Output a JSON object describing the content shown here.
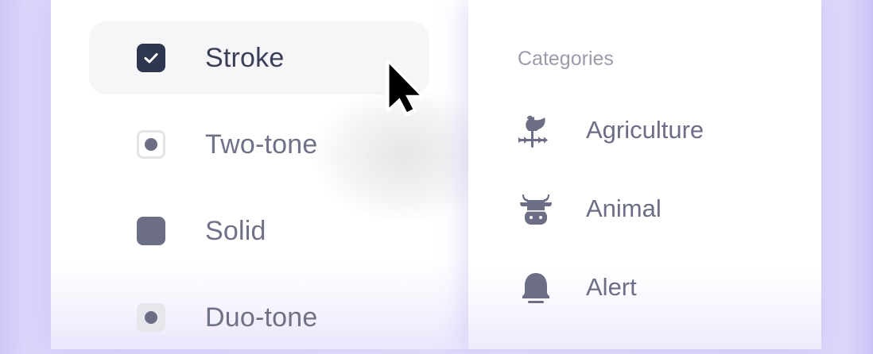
{
  "style_options": {
    "items": [
      {
        "label": "Stroke",
        "state": "checked"
      },
      {
        "label": "Two-tone",
        "state": "unchecked"
      },
      {
        "label": "Solid",
        "state": "unchecked"
      },
      {
        "label": "Duo-tone",
        "state": "unchecked"
      }
    ]
  },
  "categories": {
    "title": "Categories",
    "items": [
      {
        "label": "Agriculture",
        "icon": "weathervane-rooster-icon"
      },
      {
        "label": "Animal",
        "icon": "cow-head-icon"
      },
      {
        "label": "Alert",
        "icon": "bell-icon"
      }
    ]
  },
  "colors": {
    "accent_dark": "#2f3650",
    "text_muted": "#6f7287",
    "icon_gray": "#6b6e85",
    "background_lavender": "#ddd6fa"
  }
}
